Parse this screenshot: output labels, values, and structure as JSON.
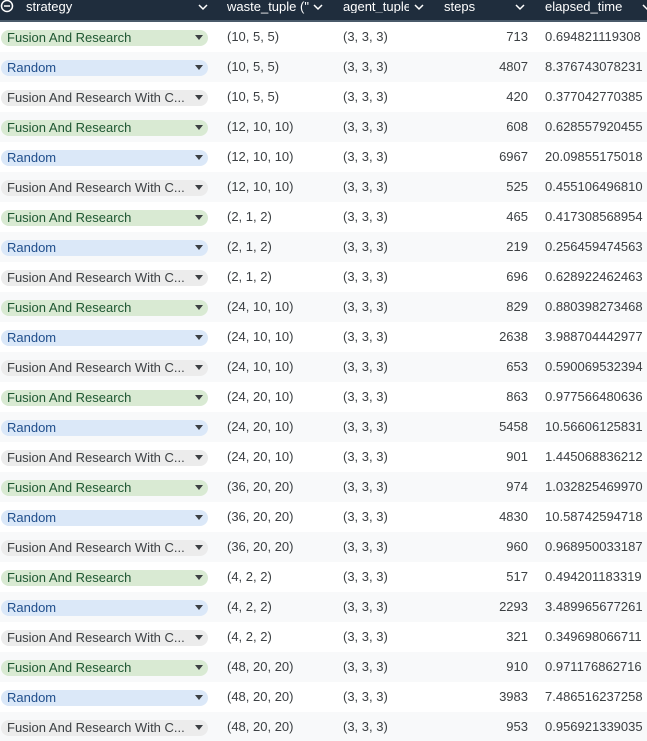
{
  "header": {
    "columns": [
      {
        "key": "strategy",
        "label": "strategy"
      },
      {
        "key": "waste",
        "label": "waste_tuple (\""
      },
      {
        "key": "agent",
        "label": "agent_tuple"
      },
      {
        "key": "steps",
        "label": "steps"
      },
      {
        "key": "elapsed",
        "label": "elapsed_time"
      }
    ]
  },
  "colors": {
    "header_bg": "#1f2d3d",
    "chip_fusion": "#d9ead3",
    "chip_random": "#dbe8f8",
    "chip_fusion_comm": "#ececec"
  },
  "rows": [
    {
      "strategy": "Fusion And Research",
      "kind": "green",
      "waste": "(10, 5, 5)",
      "agent": "(3, 3, 3)",
      "steps": "713",
      "elapsed": "0.694821119308"
    },
    {
      "strategy": "Random",
      "kind": "blue",
      "waste": "(10, 5, 5)",
      "agent": "(3, 3, 3)",
      "steps": "4807",
      "elapsed": "8.376743078231"
    },
    {
      "strategy": "Fusion And Research With C...",
      "kind": "grey",
      "waste": "(10, 5, 5)",
      "agent": "(3, 3, 3)",
      "steps": "420",
      "elapsed": "0.377042770385"
    },
    {
      "strategy": "Fusion And Research",
      "kind": "green",
      "waste": "(12, 10, 10)",
      "agent": "(3, 3, 3)",
      "steps": "608",
      "elapsed": "0.628557920455"
    },
    {
      "strategy": "Random",
      "kind": "blue",
      "waste": "(12, 10, 10)",
      "agent": "(3, 3, 3)",
      "steps": "6967",
      "elapsed": "20.09855175018"
    },
    {
      "strategy": "Fusion And Research With C...",
      "kind": "grey",
      "waste": "(12, 10, 10)",
      "agent": "(3, 3, 3)",
      "steps": "525",
      "elapsed": "0.455106496810"
    },
    {
      "strategy": "Fusion And Research",
      "kind": "green",
      "waste": "(2, 1, 2)",
      "agent": "(3, 3, 3)",
      "steps": "465",
      "elapsed": "0.417308568954"
    },
    {
      "strategy": "Random",
      "kind": "blue",
      "waste": "(2, 1, 2)",
      "agent": "(3, 3, 3)",
      "steps": "219",
      "elapsed": "0.256459474563"
    },
    {
      "strategy": "Fusion And Research With C...",
      "kind": "grey",
      "waste": "(2, 1, 2)",
      "agent": "(3, 3, 3)",
      "steps": "696",
      "elapsed": "0.628922462463"
    },
    {
      "strategy": "Fusion And Research",
      "kind": "green",
      "waste": "(24, 10, 10)",
      "agent": "(3, 3, 3)",
      "steps": "829",
      "elapsed": "0.880398273468"
    },
    {
      "strategy": "Random",
      "kind": "blue",
      "waste": "(24, 10, 10)",
      "agent": "(3, 3, 3)",
      "steps": "2638",
      "elapsed": "3.988704442977"
    },
    {
      "strategy": "Fusion And Research With C...",
      "kind": "grey",
      "waste": "(24, 10, 10)",
      "agent": "(3, 3, 3)",
      "steps": "653",
      "elapsed": "0.590069532394"
    },
    {
      "strategy": "Fusion And Research",
      "kind": "green",
      "waste": "(24, 20, 10)",
      "agent": "(3, 3, 3)",
      "steps": "863",
      "elapsed": "0.977566480636"
    },
    {
      "strategy": "Random",
      "kind": "blue",
      "waste": "(24, 20, 10)",
      "agent": "(3, 3, 3)",
      "steps": "5458",
      "elapsed": "10.56606125831"
    },
    {
      "strategy": "Fusion And Research With C...",
      "kind": "grey",
      "waste": "(24, 20, 10)",
      "agent": "(3, 3, 3)",
      "steps": "901",
      "elapsed": "1.445068836212"
    },
    {
      "strategy": "Fusion And Research",
      "kind": "green",
      "waste": "(36, 20, 20)",
      "agent": "(3, 3, 3)",
      "steps": "974",
      "elapsed": "1.032825469970"
    },
    {
      "strategy": "Random",
      "kind": "blue",
      "waste": "(36, 20, 20)",
      "agent": "(3, 3, 3)",
      "steps": "4830",
      "elapsed": "10.58742594718"
    },
    {
      "strategy": "Fusion And Research With C...",
      "kind": "grey",
      "waste": "(36, 20, 20)",
      "agent": "(3, 3, 3)",
      "steps": "960",
      "elapsed": "0.968950033187"
    },
    {
      "strategy": "Fusion And Research",
      "kind": "green",
      "waste": "(4, 2, 2)",
      "agent": "(3, 3, 3)",
      "steps": "517",
      "elapsed": "0.494201183319"
    },
    {
      "strategy": "Random",
      "kind": "blue",
      "waste": "(4, 2, 2)",
      "agent": "(3, 3, 3)",
      "steps": "2293",
      "elapsed": "3.489965677261"
    },
    {
      "strategy": "Fusion And Research With C...",
      "kind": "grey",
      "waste": "(4, 2, 2)",
      "agent": "(3, 3, 3)",
      "steps": "321",
      "elapsed": "0.349698066711"
    },
    {
      "strategy": "Fusion And Research",
      "kind": "green",
      "waste": "(48, 20, 20)",
      "agent": "(3, 3, 3)",
      "steps": "910",
      "elapsed": "0.971176862716"
    },
    {
      "strategy": "Random",
      "kind": "blue",
      "waste": "(48, 20, 20)",
      "agent": "(3, 3, 3)",
      "steps": "3983",
      "elapsed": "7.486516237258"
    },
    {
      "strategy": "Fusion And Research With C...",
      "kind": "grey",
      "waste": "(48, 20, 20)",
      "agent": "(3, 3, 3)",
      "steps": "953",
      "elapsed": "0.956921339035"
    }
  ]
}
